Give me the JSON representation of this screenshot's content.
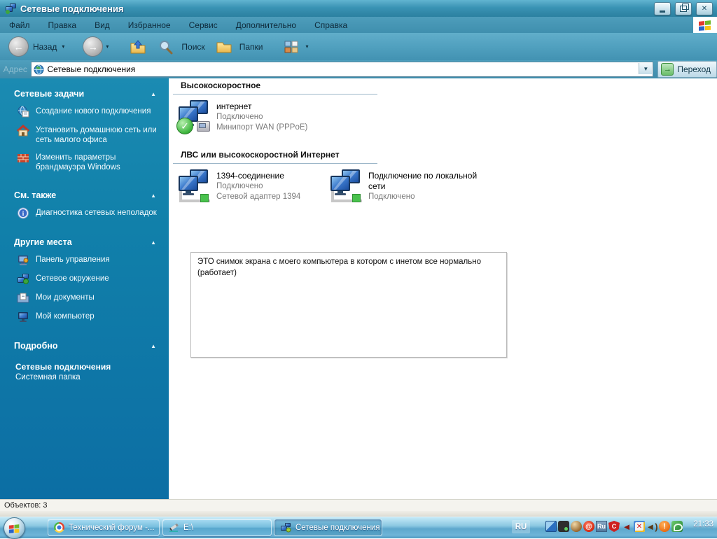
{
  "window": {
    "title": "Сетевые подключения",
    "controls": {
      "close_glyph": "✕"
    }
  },
  "menu": {
    "items": [
      "Файл",
      "Правка",
      "Вид",
      "Избранное",
      "Сервис",
      "Дополнительно",
      "Справка"
    ]
  },
  "toolbar": {
    "back_label": "Назад",
    "back_glyph": "←",
    "forward_glyph": "→",
    "search_label": "Поиск",
    "folders_label": "Папки",
    "dropdown_glyph": "▾"
  },
  "address": {
    "label": "Адрес",
    "value": "Сетевые подключения",
    "dropdown_glyph": "▼",
    "go_label": "Переход",
    "go_arrow": "→"
  },
  "sidebar": {
    "collapse_glyph": "▲",
    "sections": [
      {
        "title": "Сетевые задачи",
        "items": [
          {
            "label": "Создание нового подключения"
          },
          {
            "label": "Установить домашнюю сеть или сеть малого офиса"
          },
          {
            "label": "Изменить параметры брандмауэра Windows"
          }
        ]
      },
      {
        "title": "См. также",
        "items": [
          {
            "label": "Диагностика сетевых неполадок"
          }
        ]
      },
      {
        "title": "Другие места",
        "items": [
          {
            "label": "Панель управления"
          },
          {
            "label": "Сетевое окружение"
          },
          {
            "label": "Мои документы"
          },
          {
            "label": "Мой компьютер"
          }
        ]
      },
      {
        "title": "Подробно",
        "detail": {
          "title": "Сетевые подключения",
          "subtitle": "Системная папка"
        }
      }
    ]
  },
  "main": {
    "groups": [
      {
        "header": "Высокоскоростное",
        "items": [
          {
            "name": "интернет",
            "status": "Подключено",
            "device": "Минипорт WAN (PPPoE)"
          }
        ]
      },
      {
        "header": "ЛВС или высокоскоростной Интернет",
        "items": [
          {
            "name": "1394-соединение",
            "status": "Подключено",
            "device": "Сетевой адаптер 1394"
          },
          {
            "name": "Подключение по локальной сети",
            "status": "Подключено"
          }
        ]
      }
    ],
    "note": "ЭТО снимок экрана с моего компьютера в котором с инетом все нормально (работает)"
  },
  "statusbar": {
    "text": "Объектов: 3"
  },
  "taskbar": {
    "tasks": [
      {
        "label": "Технический форум -...",
        "icon": "chrome-icon"
      },
      {
        "label": "E:\\",
        "icon": "editor-icon"
      },
      {
        "label": "Сетевые подключения",
        "icon": "network-icon",
        "active": true
      }
    ],
    "language": "RU",
    "clock": "21:33",
    "tray": [
      {
        "name": "network-tray-icon",
        "glyph": ""
      },
      {
        "name": "removable-device-icon",
        "glyph": ""
      },
      {
        "name": "app-orb-icon",
        "glyph": ""
      },
      {
        "name": "download-master-icon",
        "glyph": "@"
      },
      {
        "name": "punto-switcher-icon",
        "glyph": "Ru"
      },
      {
        "name": "shield-icon",
        "glyph": "C"
      },
      {
        "name": "volume-muted-icon",
        "glyph": "◄"
      },
      {
        "name": "network-error-icon",
        "glyph": "✕"
      },
      {
        "name": "volume-icon",
        "glyph": "◄)"
      },
      {
        "name": "warning-icon",
        "glyph": "!"
      },
      {
        "name": "nvidia-icon",
        "glyph": ""
      }
    ]
  },
  "colors": {
    "titlebar_teal": "#3a93b4",
    "sidebar_top": "#1b8bb2",
    "sidebar_bottom": "#0c6ea4",
    "taskbar_blue": "#6fb5d8",
    "connected_green": "#3db53d",
    "warning_orange": "#e86a10"
  }
}
